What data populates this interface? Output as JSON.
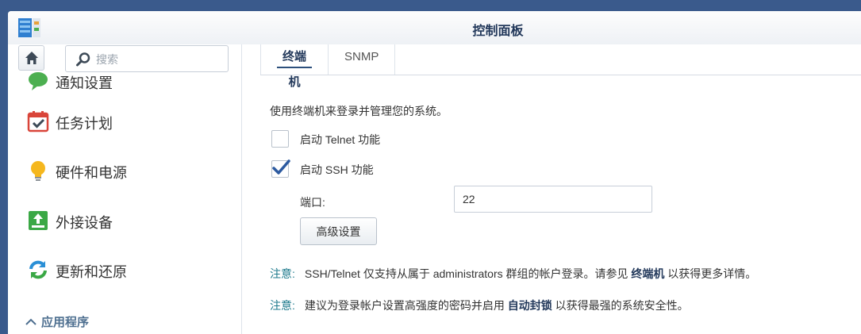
{
  "window": {
    "title": "控制面板"
  },
  "sidebar": {
    "search_placeholder": "搜索",
    "items": [
      {
        "label": "通知设置",
        "icon": "chat-bubble-icon"
      },
      {
        "label": "任务计划",
        "icon": "calendar-check-icon"
      },
      {
        "label": "硬件和电源",
        "icon": "lightbulb-icon"
      },
      {
        "label": "外接设备",
        "icon": "external-device-icon"
      },
      {
        "label": "更新和还原",
        "icon": "refresh-icon"
      }
    ],
    "section_label": "应用程序"
  },
  "tabs": [
    {
      "label": "终端机",
      "active": true
    },
    {
      "label": "SNMP",
      "active": false
    }
  ],
  "terminal": {
    "description": "使用终端机来登录并管理您的系统。",
    "telnet": {
      "label": "启动 Telnet 功能",
      "checked": false
    },
    "ssh": {
      "label": "启动 SSH 功能",
      "checked": true
    },
    "port_label": "端口:",
    "port_value": "22",
    "advanced_button": "高级设置"
  },
  "notes": [
    {
      "tag": "注意:",
      "before": "SSH/Telnet 仅支持从属于 administrators 群组的帐户登录。请参见 ",
      "link": "终端机",
      "after": " 以获得更多详情。"
    },
    {
      "tag": "注意:",
      "before": "建议为登录帐户设置高强度的密码并启用 ",
      "link": "自动封锁",
      "after": " 以获得最强的系统安全性。"
    }
  ],
  "colors": {
    "accent": "#2c4f7c",
    "note_tag": "#1e7a8c",
    "checkmark": "#2c5aa0"
  }
}
